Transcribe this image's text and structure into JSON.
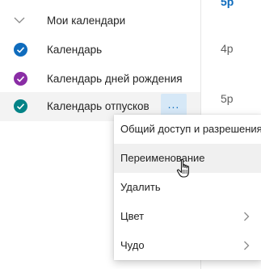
{
  "sidebar": {
    "group_label": "Мои календари",
    "calendars": [
      {
        "label": "Календарь",
        "color": "#0f6cbd"
      },
      {
        "label": "Календарь дней рождения",
        "color": "#8a2da5"
      },
      {
        "label": "Календарь отпусков",
        "color": "#038387"
      }
    ],
    "more_label": "..."
  },
  "time_column": {
    "labels": [
      "5p",
      "4p",
      "5p"
    ]
  },
  "context_menu": {
    "items": [
      {
        "label": "Общий доступ и разрешения"
      },
      {
        "label": "Переименование"
      },
      {
        "label": "Удалить"
      },
      {
        "label": "Цвет"
      },
      {
        "label": "Чудо"
      }
    ]
  },
  "colors": {
    "accent": "#0f6cbd",
    "selected_row_bg": "#f3f3f3",
    "more_button_bg": "#d6e8f7"
  },
  "icons": {
    "group_toggle": "chevron-down-icon",
    "calendar_check": "checkmark-icon",
    "submenu": "chevron-right-icon",
    "cursor": "hand-pointer-icon"
  }
}
